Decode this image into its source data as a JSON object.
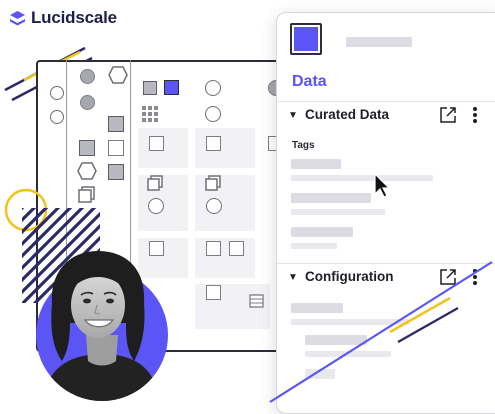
{
  "brand": {
    "name": "Lucidscale",
    "accent": "#5a55f4",
    "dark": "#1d1f4b",
    "yellow": "#f3c318"
  },
  "panel": {
    "title": "Data",
    "sections": [
      {
        "label": "Curated Data",
        "expanded": true,
        "sublabel": "Tags"
      },
      {
        "label": "Configuration",
        "expanded": true
      }
    ],
    "icons": [
      "expand-icon",
      "more-vertical-icon"
    ]
  },
  "canvas": {
    "icons": [
      "circle-shape-icon",
      "hexagon-shape-icon",
      "square-shape-icon",
      "grid-icon",
      "mouse-cursor-icon"
    ]
  }
}
